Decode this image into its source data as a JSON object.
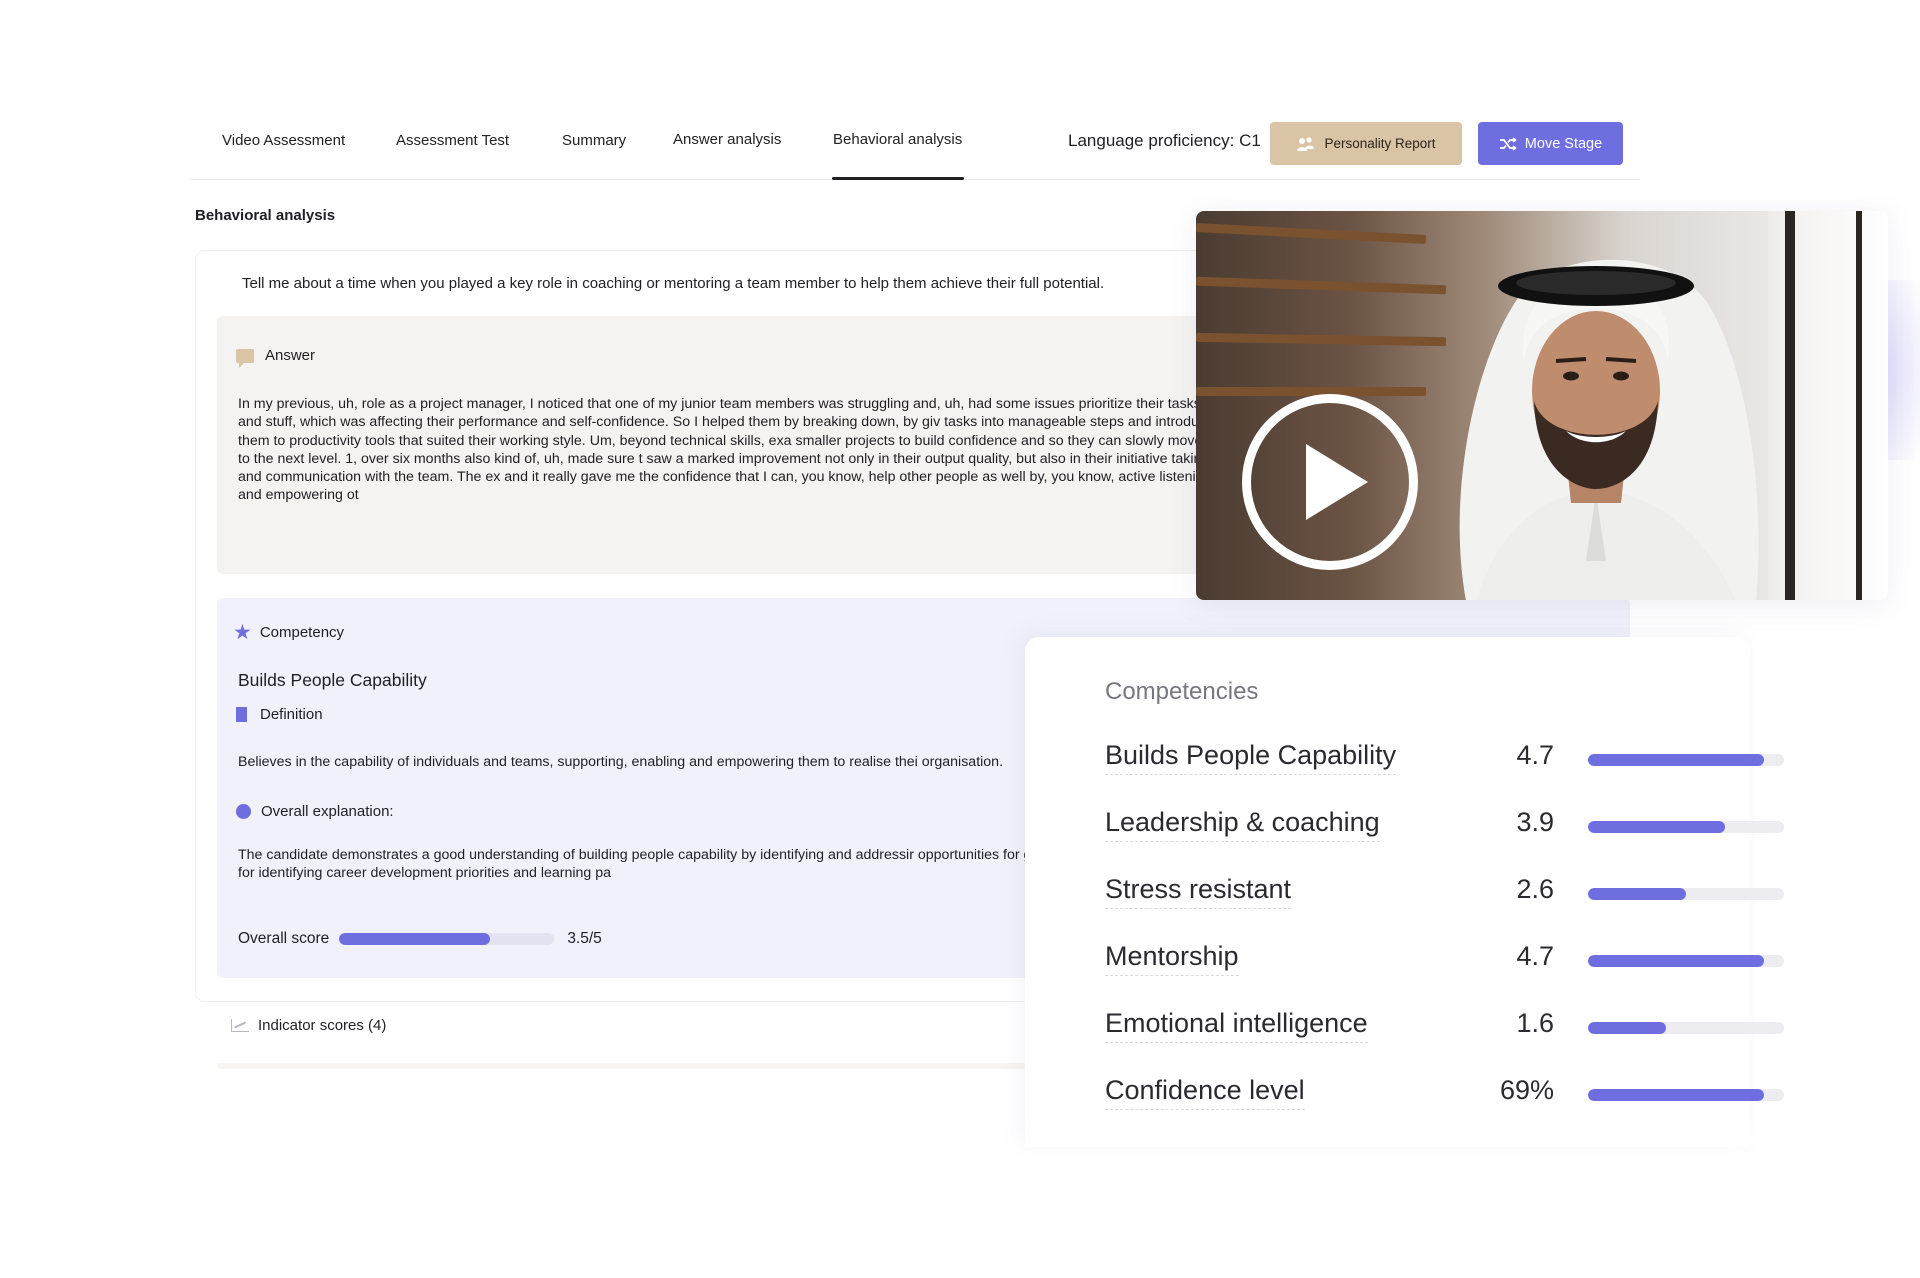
{
  "tabs": [
    {
      "label": "Video Assessment",
      "active": false
    },
    {
      "label": "Assessment Test",
      "active": false
    },
    {
      "label": "Summary",
      "active": false
    },
    {
      "label": "Answer analysis",
      "active": false
    },
    {
      "label": "Behavioral analysis",
      "active": true
    }
  ],
  "language_proficiency": "Language proficiency: C1",
  "buttons": {
    "personality_report": "Personality Report",
    "move_stage": "Move Stage"
  },
  "section_title": "Behavioral analysis",
  "question": "Tell me about a time when you played a key role in coaching or mentoring a team member to help them achieve their full potential.",
  "answer": {
    "heading": "Answer",
    "text": "In my previous, uh, role as a project manager, I noticed that one of my junior team members was struggling and, uh, had some issues prioritize their tasks and stuff, which was affecting their performance and self-confidence. So I helped them by breaking down, by giv tasks into manageable steps and introduce them to productivity tools that suited their working style. Um, beyond technical skills, exa smaller projects to build confidence and so they can slowly move up to the next level. 1, over six months also kind of, uh, made sure t saw a marked improvement not only in their output quality, but also in their initiative taking and communication with the team. The ex and it really gave me the confidence that I can, you know, help other people as well by, you know, active listening and empowering ot"
  },
  "competency": {
    "heading": "Competency",
    "name": "Builds People Capability",
    "definition_heading": "Definition",
    "definition_text": "Believes in the capability of individuals and teams, supporting, enabling and empowering them to realise thei organisation.",
    "explanation_heading": "Overall explanation:",
    "explanation_text": "The candidate demonstrates a good understanding of building people capability by identifying and addressir opportunities for growth. However, the evidence for identifying career development priorities and learning pa",
    "score_label": "Overall score",
    "score_value": 3.5,
    "score_max": 5,
    "score_text": "3.5/5"
  },
  "indicator_scores": "Indicator scores (4)",
  "competencies_card": {
    "title": "Competencies",
    "rows": [
      {
        "label": "Builds People Capability",
        "value": "4.7",
        "fill": 0.9
      },
      {
        "label": "Leadership & coaching",
        "value": "3.9",
        "fill": 0.7
      },
      {
        "label": "Stress resistant",
        "value": "2.6",
        "fill": 0.5
      },
      {
        "label": "Mentorship",
        "value": "4.7",
        "fill": 0.9
      },
      {
        "label": "Emotional intelligence",
        "value": "1.6",
        "fill": 0.4
      },
      {
        "label": "Confidence level",
        "value": "69%",
        "fill": 0.9
      }
    ]
  },
  "colors": {
    "accent": "#6f6ee0",
    "personality_button": "#d9c4a6",
    "answer_bg": "#f5f3f1",
    "competency_bg": "#f1f1fb"
  },
  "icons": {
    "personality": "people-icon",
    "move_stage": "shuffle-icon",
    "answer": "chat-bubble-icon",
    "competency": "star-icon",
    "definition": "bookmark-icon",
    "explanation": "dot-icon",
    "indicator": "line-chart-icon",
    "video": "play-icon"
  }
}
